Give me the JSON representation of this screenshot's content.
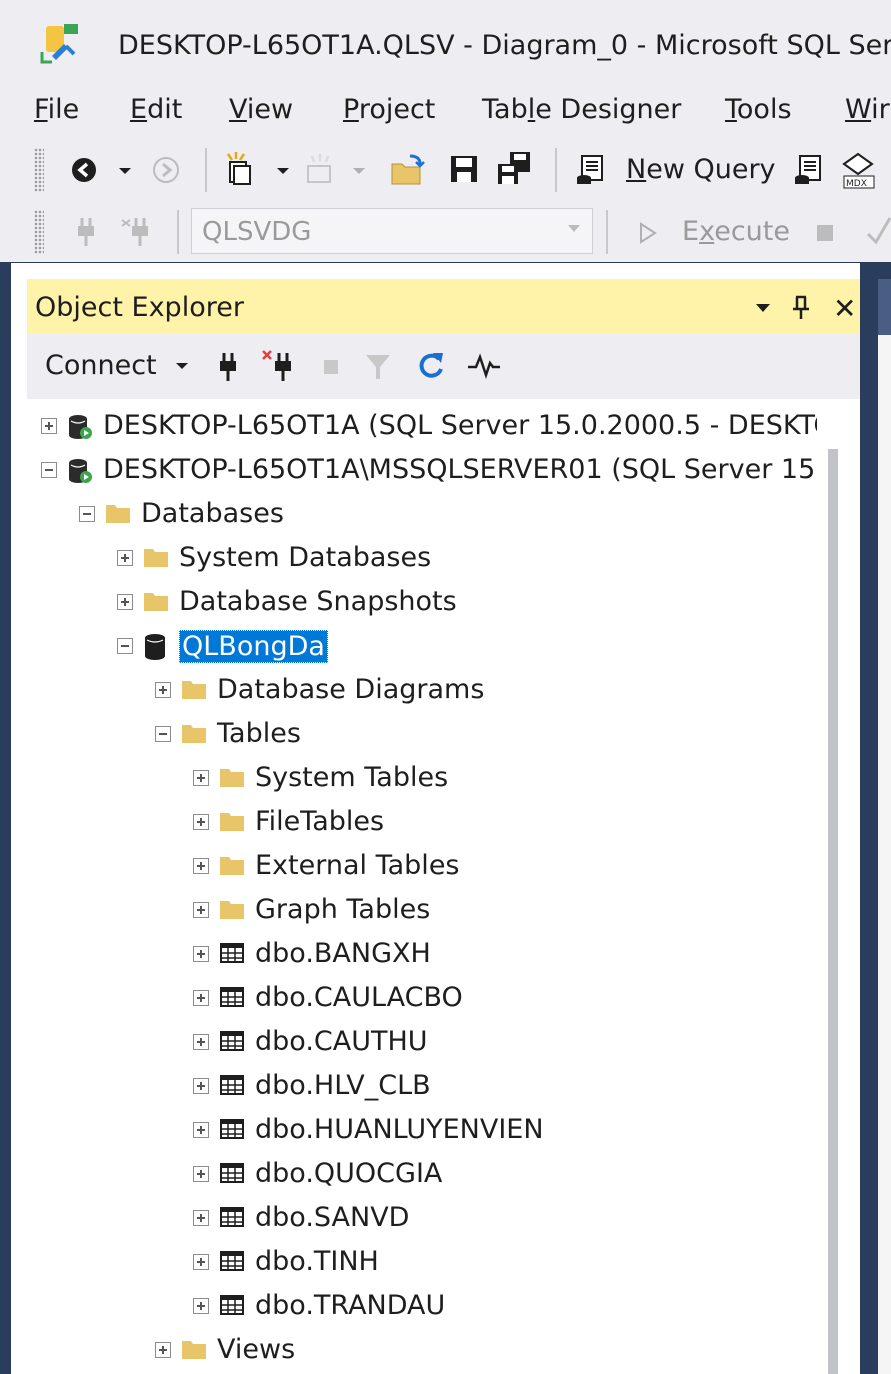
{
  "window": {
    "title": "DESKTOP-L65OT1A.QLSV - Diagram_0 - Microsoft SQL Ser"
  },
  "menu": [
    {
      "pre": "",
      "acc": "F",
      "post": "ile"
    },
    {
      "pre": "",
      "acc": "E",
      "post": "dit"
    },
    {
      "pre": "",
      "acc": "V",
      "post": "iew"
    },
    {
      "pre": "",
      "acc": "P",
      "post": "roject"
    },
    {
      "pre": "Tab",
      "acc": "l",
      "post": "e Designer"
    },
    {
      "pre": "",
      "acc": "T",
      "post": "ools"
    },
    {
      "pre": "",
      "acc": "W",
      "post": "ir"
    }
  ],
  "toolbar": {
    "new_query_acc": "N",
    "new_query_rest": "ew Query",
    "database_selector": "QLSVDG",
    "execute_pre": "E",
    "execute_acc": "x",
    "execute_post": "ecute"
  },
  "object_explorer": {
    "title": "Object Explorer",
    "connect_label": "Connect",
    "tree": [
      {
        "level": 0,
        "expander": "plus",
        "icon": "server",
        "label": "DESKTOP-L65OT1A (SQL Server 15.0.2000.5 - DESKTC"
      },
      {
        "level": 0,
        "expander": "minus",
        "icon": "server",
        "label": "DESKTOP-L65OT1A\\MSSQLSERVER01 (SQL Server 15"
      },
      {
        "level": 1,
        "expander": "minus",
        "icon": "folder",
        "label": "Databases"
      },
      {
        "level": 2,
        "expander": "plus",
        "icon": "folder",
        "label": "System Databases"
      },
      {
        "level": 2,
        "expander": "plus",
        "icon": "folder",
        "label": "Database Snapshots"
      },
      {
        "level": 2,
        "expander": "minus",
        "icon": "database",
        "label": "QLBongDa",
        "selected": true
      },
      {
        "level": 3,
        "expander": "plus",
        "icon": "folder",
        "label": "Database Diagrams"
      },
      {
        "level": 3,
        "expander": "minus",
        "icon": "folder",
        "label": "Tables"
      },
      {
        "level": 4,
        "expander": "plus",
        "icon": "folder",
        "label": "System Tables"
      },
      {
        "level": 4,
        "expander": "plus",
        "icon": "folder",
        "label": "FileTables"
      },
      {
        "level": 4,
        "expander": "plus",
        "icon": "folder",
        "label": "External Tables"
      },
      {
        "level": 4,
        "expander": "plus",
        "icon": "folder",
        "label": "Graph Tables"
      },
      {
        "level": 4,
        "expander": "plus",
        "icon": "table",
        "label": "dbo.BANGXH"
      },
      {
        "level": 4,
        "expander": "plus",
        "icon": "table",
        "label": "dbo.CAULACBO"
      },
      {
        "level": 4,
        "expander": "plus",
        "icon": "table",
        "label": "dbo.CAUTHU"
      },
      {
        "level": 4,
        "expander": "plus",
        "icon": "table",
        "label": "dbo.HLV_CLB"
      },
      {
        "level": 4,
        "expander": "plus",
        "icon": "table",
        "label": "dbo.HUANLUYENVIEN"
      },
      {
        "level": 4,
        "expander": "plus",
        "icon": "table",
        "label": "dbo.QUOCGIA"
      },
      {
        "level": 4,
        "expander": "plus",
        "icon": "table",
        "label": "dbo.SANVD"
      },
      {
        "level": 4,
        "expander": "plus",
        "icon": "table",
        "label": "dbo.TINH"
      },
      {
        "level": 4,
        "expander": "plus",
        "icon": "table",
        "label": "dbo.TRANDAU"
      },
      {
        "level": 3,
        "expander": "plus",
        "icon": "folder",
        "label": "Views"
      }
    ]
  },
  "colors": {
    "selection": "#0078d7",
    "header_highlight": "#fef3a8",
    "folder": "#e8c568",
    "chrome": "#eeeef2",
    "frame": "#2b3d5c"
  }
}
